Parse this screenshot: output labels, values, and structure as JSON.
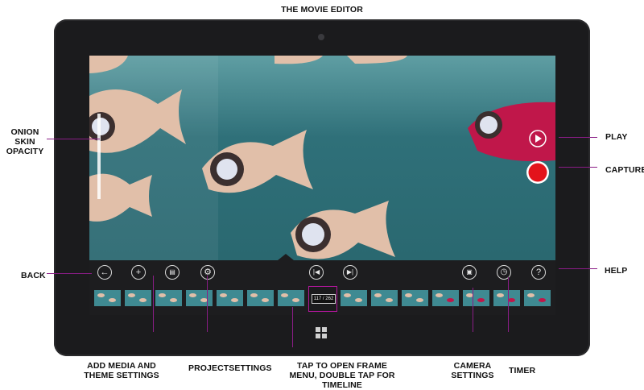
{
  "title": "THE MOVIE EDITOR",
  "labels": {
    "onion_skin": "ONION SKIN OPACITY",
    "back": "BACK",
    "add_media": "ADD MEDIA AND THEME SETTINGS",
    "project_settings": "PROJECTSETTINGS",
    "tap_open": "TAP TO OPEN FRAME MENU, DOUBLE TAP FOR TIMELINE",
    "camera_settings": "CAMERA SETTINGS",
    "timer": "TIMER",
    "help": "HELP",
    "play": "PLAY",
    "capture": "CAPTURE"
  },
  "frame_counter": "117 / 262",
  "toolbar_icons": [
    "back-icon",
    "add-icon",
    "clapperboard-icon",
    "gear-icon",
    "skip-back-icon",
    "skip-forward-icon",
    "camera-icon",
    "clock-icon",
    "help-icon"
  ],
  "colors": {
    "accent": "#8a1d86",
    "capture": "#e3131b",
    "water": "#2e6f78",
    "fish": "#e1bfa9",
    "red_fish": "#c0174a"
  }
}
